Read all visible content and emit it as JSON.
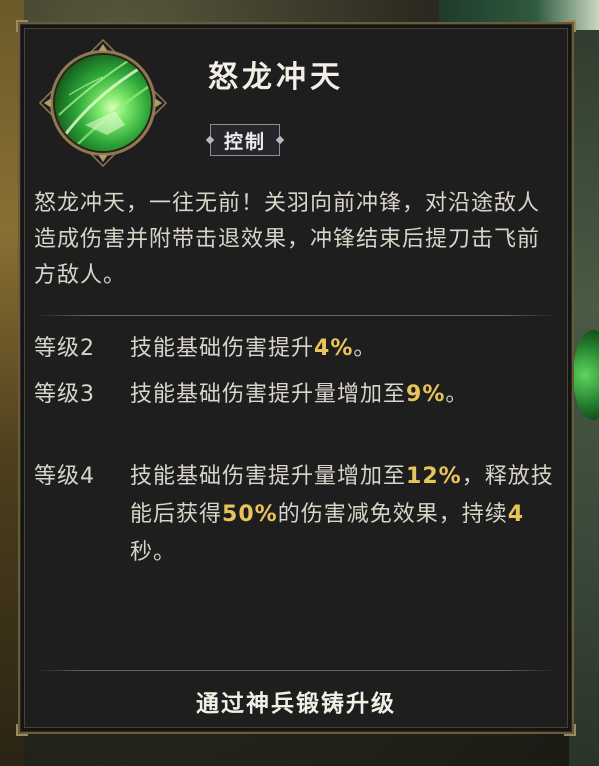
{
  "skill": {
    "name": "怒龙冲天",
    "tag": "控制",
    "icon": "green-slash-skill-icon",
    "description": "怒龙冲天，一往无前！关羽向前冲锋，对沿途敌人造成伤害并附带击退效果，冲锋结束后提刀击飞前方敌人。"
  },
  "levels": [
    {
      "label": "等级2",
      "parts": [
        {
          "text": "技能基础伤害提升",
          "hl": false
        },
        {
          "text": "4%",
          "hl": true
        },
        {
          "text": "。",
          "hl": false
        }
      ]
    },
    {
      "label": "等级3",
      "parts": [
        {
          "text": "技能基础伤害提升量增加至",
          "hl": false
        },
        {
          "text": "9%",
          "hl": true
        },
        {
          "text": "。",
          "hl": false
        }
      ]
    },
    {
      "label": "等级4",
      "parts": [
        {
          "text": "技能基础伤害提升量增加至",
          "hl": false
        },
        {
          "text": "12%",
          "hl": true
        },
        {
          "text": "，释放技能后获得",
          "hl": false
        },
        {
          "text": "50%",
          "hl": true
        },
        {
          "text": "的伤害减免效果，持续",
          "hl": false
        },
        {
          "text": "4",
          "hl": true
        },
        {
          "text": "秒。",
          "hl": false
        }
      ]
    }
  ],
  "footer": {
    "upgrade_label": "通过神兵锻铸升级"
  },
  "colors": {
    "highlight": "#e8c45a",
    "body_text": "#d8d4c8",
    "panel_bg": "#1e1e1e",
    "frame_gold": "#6a5b3a"
  }
}
